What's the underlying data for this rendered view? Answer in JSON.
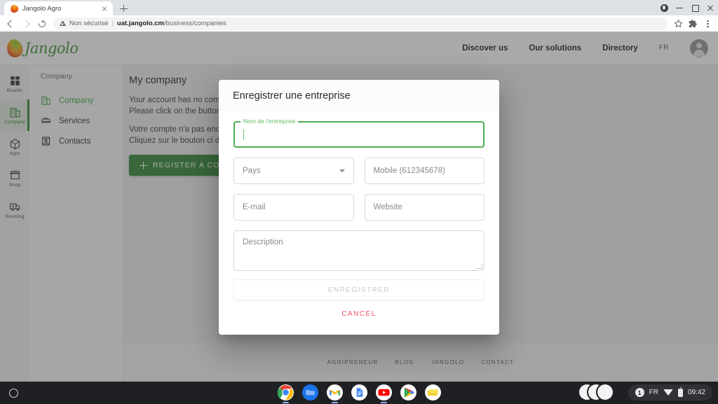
{
  "browser": {
    "tab": {
      "title": "Jangolo Agro",
      "favicon": "mango-favicon",
      "close_icon": "close-icon"
    },
    "new_tab_icon": "plus-icon",
    "window_controls": [
      "profile-shield-icon",
      "minimize-icon",
      "maximize-icon",
      "close-icon"
    ],
    "nav": {
      "back_icon": "arrow-back-icon",
      "forward_icon": "arrow-forward-icon",
      "reload_icon": "reload-icon"
    },
    "omnibox": {
      "security_icon": "warning-triangle-icon",
      "security_label": "Non sécurisé",
      "separator": "|",
      "url_host": "uat.jangolo.cm",
      "url_path": "/business/companies"
    },
    "actions": [
      "bookmark-star-icon",
      "extensions-puzzle-icon",
      "menu-kebab-icon"
    ]
  },
  "site": {
    "logo_text": "Jangolo",
    "nav": [
      {
        "label": "Discover us"
      },
      {
        "label": "Our solutions"
      },
      {
        "label": "Directory"
      }
    ],
    "language": "FR",
    "avatar": "account-circle-icon"
  },
  "rail": [
    {
      "label": "Boards",
      "icon": "boards-grid-icon",
      "active": false
    },
    {
      "label": "Company",
      "icon": "building-icon",
      "active": true
    },
    {
      "label": "Agro",
      "icon": "box-icon",
      "active": false
    },
    {
      "label": "Shop",
      "icon": "storefront-icon",
      "active": false
    },
    {
      "label": "Sourcing",
      "icon": "truck-icon",
      "active": false
    }
  ],
  "subnav": {
    "title": "Company",
    "items": [
      {
        "label": "Company",
        "icon": "building-icon",
        "active": true
      },
      {
        "label": "Services",
        "icon": "briefcase-icon",
        "active": false
      },
      {
        "label": "Contacts",
        "icon": "contact-card-icon",
        "active": false
      }
    ]
  },
  "content": {
    "title": "My company",
    "line_en_1": "Your account has no company registered yet.",
    "line_en_2": "Please click on the button below to register one.",
    "line_fr_1": "Votre compte n'a pas encore d'entreprise enregistrée.",
    "line_fr_2": "Cliquez sur le bouton ci dessous pour en enregistrer une.",
    "cta_label": "REGISTER A COMPANY",
    "cta_icon": "plus-icon",
    "cta_color": "#3e8e41"
  },
  "footer": {
    "links": [
      {
        "label": "AGRIPRENEUR"
      },
      {
        "label": "BLOG"
      },
      {
        "label": "JANGOLO"
      },
      {
        "label": "CONTACT"
      }
    ]
  },
  "modal": {
    "title": "Enregistrer une entreprise",
    "company_name": {
      "legend": "Nom de l'entreprise",
      "value": "",
      "focused": true,
      "accent": "#4caf50"
    },
    "country": {
      "placeholder": "Pays",
      "value": "",
      "chevron_icon": "chevron-down-icon"
    },
    "mobile": {
      "placeholder": "Mobile (612345678)",
      "value": ""
    },
    "email": {
      "placeholder": "E-mail",
      "value": ""
    },
    "website": {
      "placeholder": "Website",
      "value": ""
    },
    "description": {
      "placeholder": "Description",
      "value": ""
    },
    "submit_label": "ENREGISTRER",
    "submit_disabled": true,
    "cancel_label": "CANCEL",
    "cancel_color": "#f4516c"
  },
  "shelf": {
    "launcher_icon": "launcher-circle-icon",
    "apps": [
      {
        "name": "chrome-icon",
        "running": true
      },
      {
        "name": "files-icon",
        "running": false
      },
      {
        "name": "gmail-icon",
        "running": true
      },
      {
        "name": "docs-icon",
        "running": false
      },
      {
        "name": "youtube-icon",
        "running": true
      },
      {
        "name": "play-store-icon",
        "running": false
      },
      {
        "name": "keep-icon",
        "running": false
      }
    ],
    "status": {
      "notification_count": "1",
      "language": "FR",
      "wifi_icon": "wifi-icon",
      "battery_icon": "battery-icon",
      "time": "09:42"
    }
  }
}
